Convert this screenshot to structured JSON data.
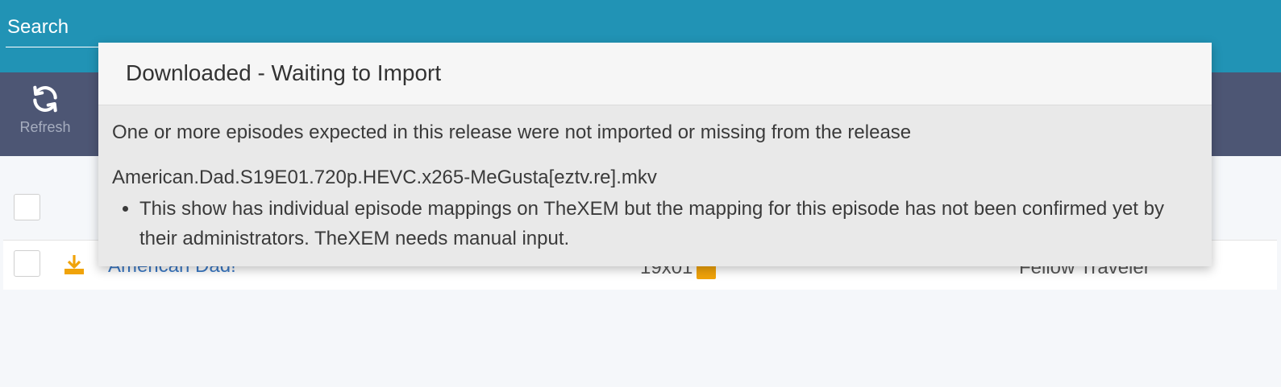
{
  "header": {
    "search_placeholder": "Search"
  },
  "toolbar": {
    "refresh_label": "Refresh",
    "refresh_icon": "refresh-icon"
  },
  "table": {
    "rows": [
      {
        "series": "American Dad!",
        "episode": "19x01",
        "title": "Fellow Traveler",
        "status_icon": "download-icon",
        "status_color": "#f0a30a"
      }
    ]
  },
  "popover": {
    "title": "Downloaded - Waiting to Import",
    "message": "One or more episodes expected in this release were not imported or missing from the release",
    "file_name": "American.Dad.S19E01.720p.HEVC.x265-MeGusta[eztv.re].mkv",
    "reasons": [
      "This show has individual episode mappings on TheXEM but the mapping for this episode has not been confirmed yet by their administrators. TheXEM needs manual input."
    ]
  },
  "colors": {
    "header_bg": "#2193b5",
    "toolbar_bg": "#4d5674",
    "accent": "#f0a30a",
    "link": "#3a78c4"
  }
}
